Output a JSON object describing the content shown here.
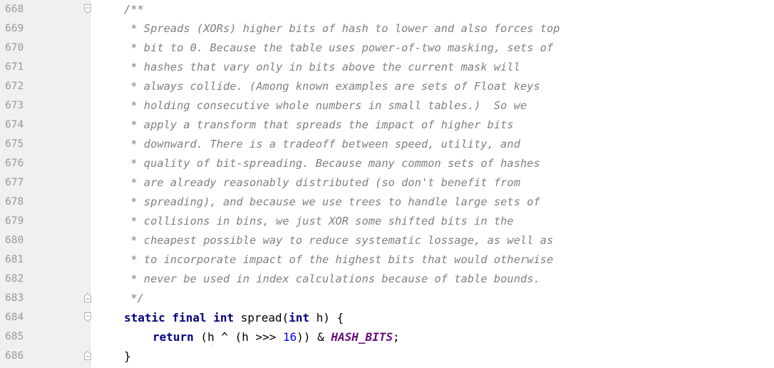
{
  "editor": {
    "line_numbers": [
      "668",
      "669",
      "670",
      "671",
      "672",
      "673",
      "674",
      "675",
      "676",
      "677",
      "678",
      "679",
      "680",
      "681",
      "682",
      "683",
      "684",
      "685",
      "686"
    ],
    "doc_comment": {
      "open": "/**",
      "lines": [
        " * Spreads (XORs) higher bits of hash to lower and also forces top",
        " * bit to 0. Because the table uses power-of-two masking, sets of",
        " * hashes that vary only in bits above the current mask will",
        " * always collide. (Among known examples are sets of Float keys",
        " * holding consecutive whole numbers in small tables.)  So we",
        " * apply a transform that spreads the impact of higher bits",
        " * downward. There is a tradeoff between speed, utility, and",
        " * quality of bit-spreading. Because many common sets of hashes",
        " * are already reasonably distributed (so don't benefit from",
        " * spreading), and because we use trees to handle large sets of",
        " * collisions in bins, we just XOR some shifted bits in the",
        " * cheapest possible way to reduce systematic lossage, as well as",
        " * to incorporate impact of the highest bits that would otherwise",
        " * never be used in index calculations because of table bounds."
      ],
      "close": " */"
    },
    "method_signature": {
      "kw_static": "static",
      "kw_final": "final",
      "kw_int": "int",
      "name_open": " spread(",
      "param_kw_int": "int",
      "param_rest": " h) {"
    },
    "return_line": {
      "kw_return": "return",
      "expr_a": " (h ^ (h >>> ",
      "number": "16",
      "expr_b": ")) & ",
      "constant": "HASH_BITS",
      "end": ";"
    },
    "closing_brace": "}",
    "colors": {
      "gutter_bg": "#f0f0f0",
      "line_number": "#999999",
      "comment": "#808080",
      "keyword": "#000080",
      "number": "#0000ff",
      "constant": "#660e7a"
    },
    "fold_markers": [
      "fold-open-icon",
      "fold-close-icon",
      "fold-open-icon",
      "fold-close-icon"
    ]
  }
}
